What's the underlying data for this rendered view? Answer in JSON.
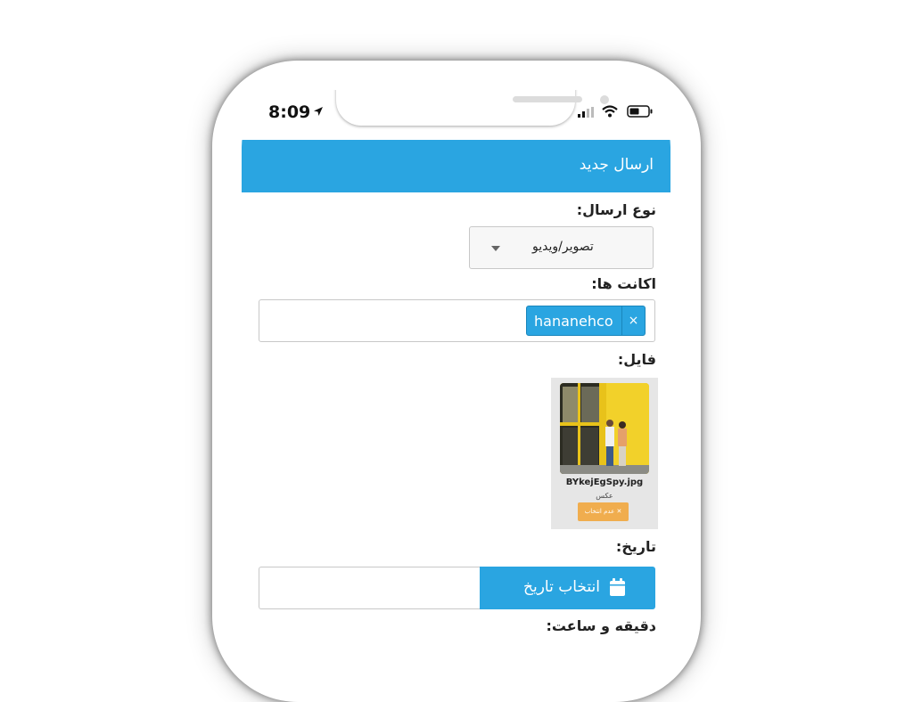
{
  "status_bar": {
    "time": "8:09",
    "icons": [
      "location-arrow-icon",
      "cellular-signal-icon",
      "wifi-icon",
      "battery-icon"
    ]
  },
  "header": {
    "title": "ارسال جدید",
    "background_color": "#2aa5e1"
  },
  "form": {
    "send_type": {
      "label": "نوع ارسال:",
      "selected": "تصویر/ویدیو"
    },
    "accounts": {
      "label": "اکانت ها:",
      "tags": [
        {
          "text": "hananehco",
          "remove": "×"
        }
      ]
    },
    "file": {
      "label": "فایل:",
      "items": [
        {
          "name": "BYkejEgSpy.jpg",
          "type": "عکس",
          "deselect": "✕ عدم انتخاب"
        }
      ]
    },
    "date": {
      "label": "تاریخ:",
      "button_label": "انتخاب تاریخ",
      "value": ""
    },
    "time": {
      "label": "دقیقه و ساعت:"
    }
  },
  "colors": {
    "accent": "#2aa5e1",
    "warning": "#f0ad4e"
  }
}
